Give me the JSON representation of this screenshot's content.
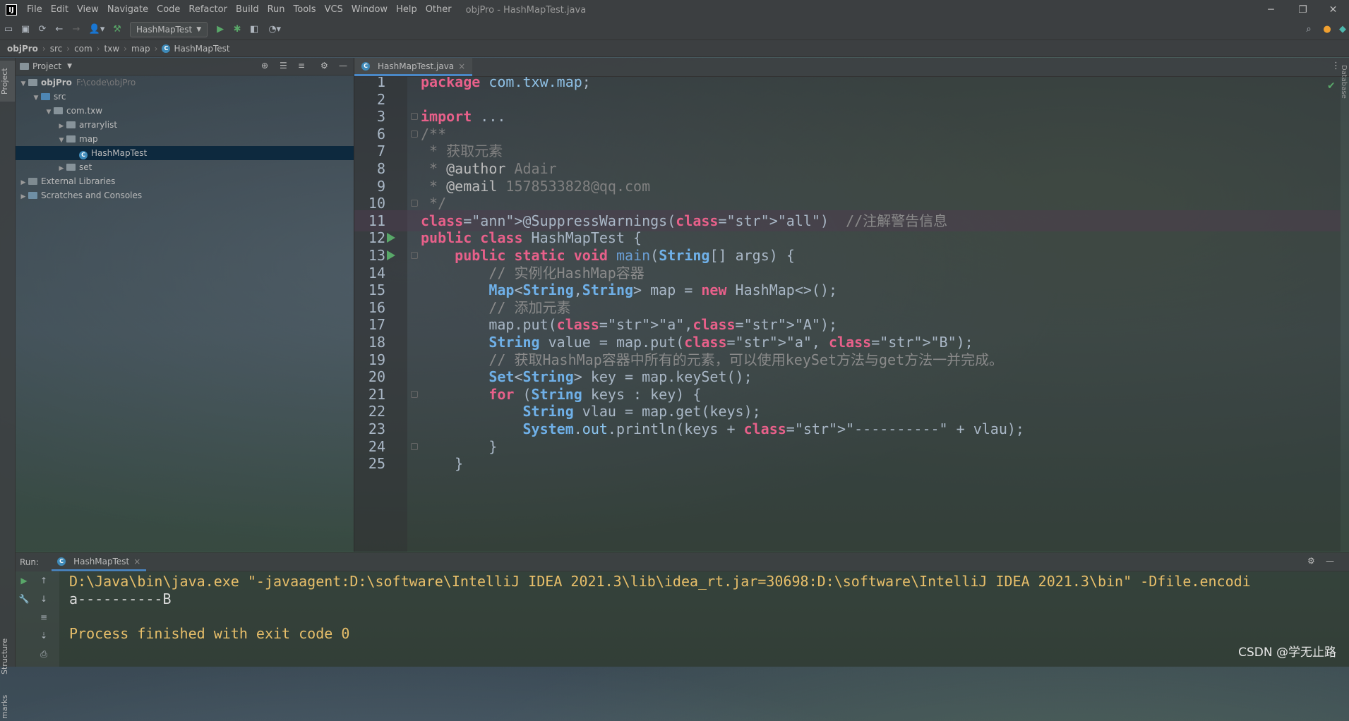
{
  "window": {
    "title": "objPro - HashMapTest.java",
    "app_logo": "IJ",
    "minimize": "─",
    "restore": "❐",
    "close": "✕"
  },
  "menu": [
    "File",
    "Edit",
    "View",
    "Navigate",
    "Code",
    "Refactor",
    "Build",
    "Run",
    "Tools",
    "VCS",
    "Window",
    "Help",
    "Other"
  ],
  "toolbar": {
    "run_config": "HashMapTest",
    "icons": [
      "folder-icon",
      "save-icon",
      "sync-icon",
      "back-icon",
      "forward-icon",
      "user-icon",
      "build-icon",
      "run-icon",
      "debug-icon",
      "coverage-icon",
      "profile-icon",
      "search-icon",
      "update-icon",
      "plugin-icon"
    ]
  },
  "breadcrumb": [
    "objPro",
    "src",
    "com",
    "txw",
    "map",
    "HashMapTest"
  ],
  "left_strip": {
    "project_tab": "Project",
    "structure_tab": "Structure",
    "bookmarks_tab": "marks"
  },
  "project": {
    "header": "Project",
    "tree": [
      {
        "label": "objPro",
        "path": "F:\\code\\objPro",
        "depth": 0,
        "arrow": "▼",
        "kind": "project",
        "bold": true
      },
      {
        "label": "src",
        "depth": 1,
        "arrow": "▼",
        "kind": "src"
      },
      {
        "label": "com.txw",
        "depth": 2,
        "arrow": "▼",
        "kind": "package"
      },
      {
        "label": "arrarylist",
        "depth": 3,
        "arrow": "▶",
        "kind": "package"
      },
      {
        "label": "map",
        "depth": 3,
        "arrow": "▼",
        "kind": "package"
      },
      {
        "label": "HashMapTest",
        "depth": 4,
        "arrow": "",
        "kind": "class",
        "selected": true
      },
      {
        "label": "set",
        "depth": 3,
        "arrow": "▶",
        "kind": "package"
      },
      {
        "label": "External Libraries",
        "depth": 0,
        "arrow": "▶",
        "kind": "lib"
      },
      {
        "label": "Scratches and Consoles",
        "depth": 0,
        "arrow": "▶",
        "kind": "scratch"
      }
    ]
  },
  "editor": {
    "tab": "HashMapTest.java",
    "tab_close": "×",
    "right_label": "Database",
    "lines": [
      {
        "n": "1",
        "text": "package com.txw.map;"
      },
      {
        "n": "2",
        "text": ""
      },
      {
        "n": "3",
        "text": "import ..."
      },
      {
        "n": "6",
        "text": "/**"
      },
      {
        "n": "7",
        "text": " * 获取元素"
      },
      {
        "n": "8",
        "text": " * @author Adair"
      },
      {
        "n": "9",
        "text": " * @email 1578533828@qq.com"
      },
      {
        "n": "10",
        "text": " */"
      },
      {
        "n": "11",
        "text": "@SuppressWarnings(\"all\")  //注解警告信息"
      },
      {
        "n": "12",
        "text": "public class HashMapTest {"
      },
      {
        "n": "13",
        "text": "    public static void main(String[] args) {"
      },
      {
        "n": "14",
        "text": "        // 实例化HashMap容器"
      },
      {
        "n": "15",
        "text": "        Map<String,String> map = new HashMap<>();"
      },
      {
        "n": "16",
        "text": "        // 添加元素"
      },
      {
        "n": "17",
        "text": "        map.put(\"a\",\"A\");"
      },
      {
        "n": "18",
        "text": "        String value = map.put(\"a\", \"B\");"
      },
      {
        "n": "19",
        "text": "        // 获取HashMap容器中所有的元素，可以使用keySet方法与get方法一并完成。"
      },
      {
        "n": "20",
        "text": "        Set<String> key = map.keySet();"
      },
      {
        "n": "21",
        "text": "        for (String keys : key) {"
      },
      {
        "n": "22",
        "text": "            String vlau = map.get(keys);"
      },
      {
        "n": "23",
        "text": "            System.out.println(keys + \"----------\" + vlau);"
      },
      {
        "n": "24",
        "text": "        }"
      },
      {
        "n": "25",
        "text": "    }"
      }
    ]
  },
  "run": {
    "label": "Run:",
    "tab": "HashMapTest",
    "tab_close": "×",
    "console": [
      "D:\\Java\\bin\\java.exe \"-javaagent:D:\\software\\IntelliJ IDEA 2021.3\\lib\\idea_rt.jar=30698:D:\\software\\IntelliJ IDEA 2021.3\\bin\" -Dfile.encodi",
      "a----------B",
      "",
      "Process finished with exit code 0"
    ]
  },
  "watermark": "CSDN @学无止路"
}
